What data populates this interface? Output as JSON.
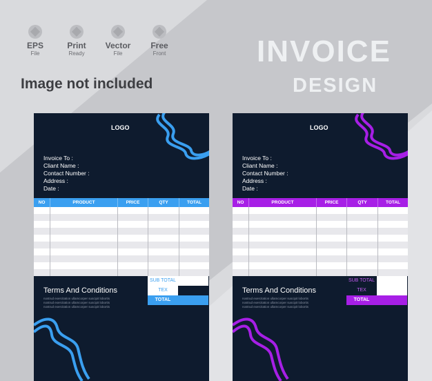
{
  "badges": [
    {
      "title": "EPS",
      "sub": "File"
    },
    {
      "title": "Print",
      "sub": "Ready"
    },
    {
      "title": "Vector",
      "sub": "File"
    },
    {
      "title": "Free",
      "sub": "Front"
    }
  ],
  "notice": "Image not included",
  "heading": {
    "line1": "INVOICE",
    "line2": "DESIGN"
  },
  "invoice": {
    "logo": "LOGO",
    "fields": [
      "Invoice To :",
      "Cliant Name :",
      "Contact Number :",
      "Address :",
      "Date :"
    ],
    "columns": [
      "NO",
      "PRODUCT",
      "PRICE",
      "QTY",
      "TOTAL"
    ],
    "terms": "Terms And Conditions",
    "lorem": [
      "nostrud exercitation ullamcorper suscipit lobortis",
      "nostrud exercitation ullamcorper suscipit lobortis",
      "nostrud exercitation ullamcorper suscipit lobortis"
    ],
    "totals": [
      "SUB TOTAL",
      "TEX",
      "TOTAL"
    ]
  },
  "colors": {
    "blue_accent": "#3a9ff0",
    "purple_accent": "#a71fe6",
    "dark": "#0e1b2e"
  }
}
